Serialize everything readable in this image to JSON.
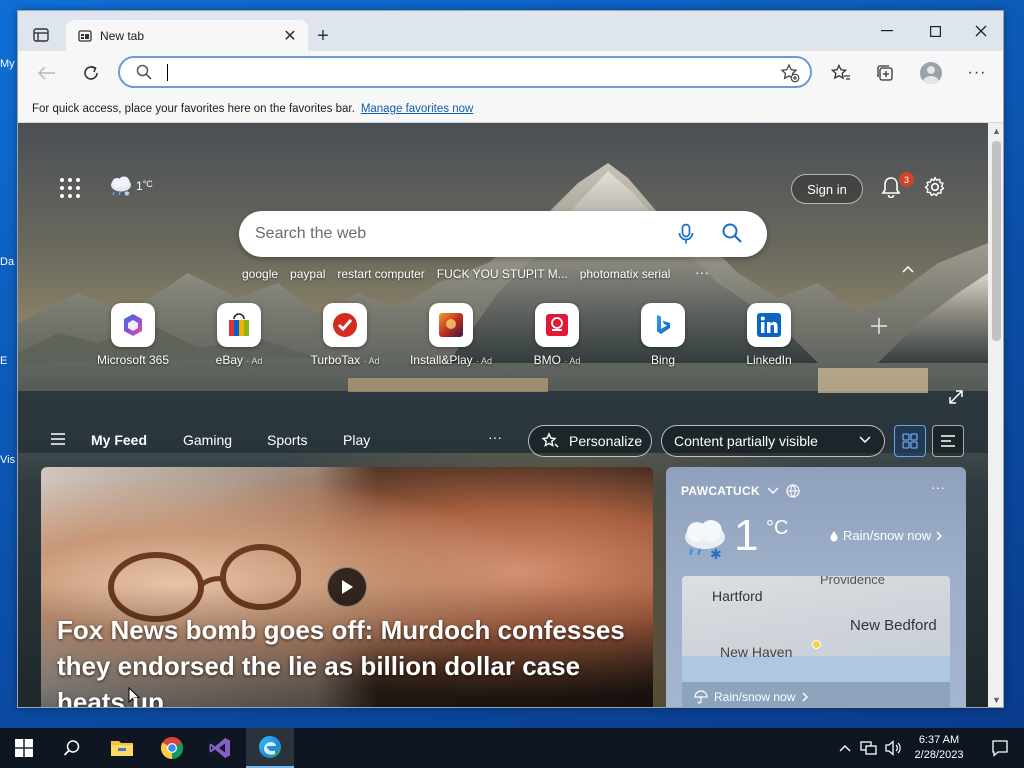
{
  "desktop": {
    "icon_labels": [
      "My",
      "Da",
      "E",
      "Vis"
    ]
  },
  "browser": {
    "tab": {
      "title": "New tab"
    },
    "address_bar": {
      "value": "",
      "placeholder": ""
    },
    "favorites_bar": {
      "message": "For quick access, place your favorites here on the favorites bar.",
      "link": "Manage favorites now"
    }
  },
  "newtab": {
    "weather_mini": {
      "temp": "1",
      "unit": "°C"
    },
    "sign_in": "Sign in",
    "notifications_count": "3",
    "search": {
      "placeholder": "Search the web"
    },
    "trending": [
      "google",
      "paypal",
      "restart computer",
      "FUCK YOU STUPIT M...",
      "photomatix serial"
    ],
    "trending_more": "···",
    "quick_links": [
      {
        "label": "Microsoft 365",
        "ad": "",
        "icon": "microsoft-365-icon"
      },
      {
        "label": "eBay",
        "ad": "· Ad",
        "icon": "ebay-icon"
      },
      {
        "label": "TurboTax",
        "ad": "· Ad",
        "icon": "turbotax-icon"
      },
      {
        "label": "Install&Play",
        "ad": "· Ad",
        "icon": "install-play-icon"
      },
      {
        "label": "BMO",
        "ad": "· Ad",
        "icon": "bmo-icon"
      },
      {
        "label": "Bing",
        "ad": "",
        "icon": "bing-icon"
      },
      {
        "label": "LinkedIn",
        "ad": "",
        "icon": "linkedin-icon"
      }
    ],
    "feed": {
      "tabs": [
        "My Feed",
        "Gaming",
        "Sports",
        "Play"
      ],
      "more": "···",
      "personalize": "Personalize",
      "content_visibility": "Content partially visible"
    },
    "hero": {
      "title": "Fox News bomb goes off: Murdoch confesses they endorsed the lie as billion dollar case heats up"
    },
    "weather_card": {
      "location": "PAWCATUCK",
      "temp": "1",
      "unit": "°C",
      "condition": "Rain/snow now",
      "map_labels": {
        "hartford": "Hartford",
        "providence": "Providence",
        "new_bedford": "New Bedford",
        "new_haven": "New Haven"
      },
      "footer": "Rain/snow now"
    }
  },
  "taskbar": {
    "time": "6:37 AM",
    "date": "2/28/2023"
  },
  "colors": {
    "accent": "#0f5fb0",
    "badge": "#d1442a",
    "taskbar": "#0e1621"
  }
}
